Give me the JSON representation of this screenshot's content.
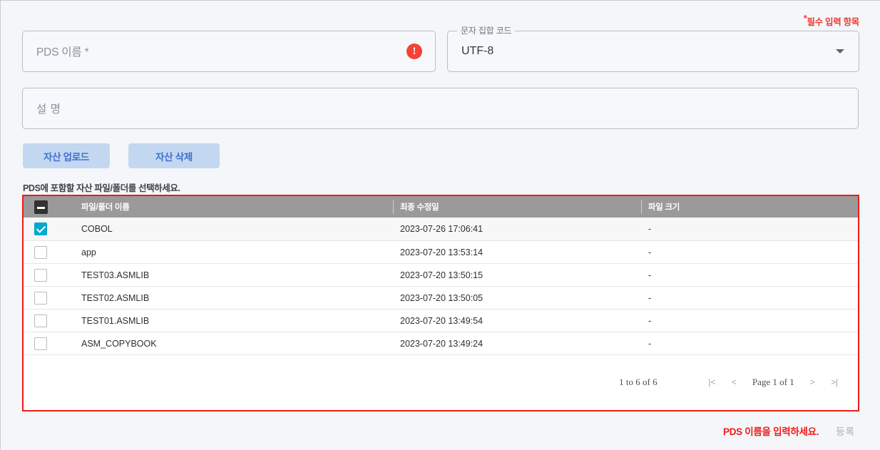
{
  "required_note": {
    "star": "*",
    "text": "필수 입력 항목"
  },
  "form": {
    "pds_name": {
      "value": "",
      "placeholder": "PDS 이름 *",
      "error_icon": "error-exclamation-icon",
      "error_icon_glyph": "!"
    },
    "charset": {
      "label": "문자 집합 코드",
      "value": "UTF-8",
      "arrow_icon": "chevron-down-icon",
      "options": [
        "UTF-8"
      ]
    },
    "description": {
      "value": "",
      "placeholder": "설 명"
    }
  },
  "toolbar": {
    "upload_label": "자산 업로드",
    "delete_label": "자산 삭제"
  },
  "helper_text": "PDS에 포함할 자산 파일/폴더를 선택하세요.",
  "grid": {
    "select_all_state": "indeterminate",
    "columns": [
      "파일/폴더 이름",
      "최종 수정일",
      "파일 크기"
    ],
    "rows": [
      {
        "checked": true,
        "name": "COBOL",
        "modified": "2023-07-26 17:06:41",
        "size": "-"
      },
      {
        "checked": false,
        "name": "app",
        "modified": "2023-07-20 13:53:14",
        "size": "-"
      },
      {
        "checked": false,
        "name": "TEST03.ASMLIB",
        "modified": "2023-07-20 13:50:15",
        "size": "-"
      },
      {
        "checked": false,
        "name": "TEST02.ASMLIB",
        "modified": "2023-07-20 13:50:05",
        "size": "-"
      },
      {
        "checked": false,
        "name": "TEST01.ASMLIB",
        "modified": "2023-07-20 13:49:54",
        "size": "-"
      },
      {
        "checked": false,
        "name": "ASM_COPYBOOK",
        "modified": "2023-07-20 13:49:24",
        "size": "-"
      }
    ],
    "pagination": {
      "summary": "1 to 6 of 6",
      "first": "|<",
      "prev": "<",
      "page_label": "Page 1 of 1",
      "next": ">",
      "last": ">|"
    }
  },
  "footer": {
    "error_message": "PDS 이름을 입력하세요.",
    "submit_label": "등록"
  },
  "colors": {
    "background": "#f4f6f9",
    "error_red": "#ee1c18",
    "accent_blue": "#3f6fd0",
    "button_blue_bg": "#c3d8f0",
    "checkbox_cyan": "#00a9ce",
    "grid_header_gray": "#9a9a9a"
  }
}
